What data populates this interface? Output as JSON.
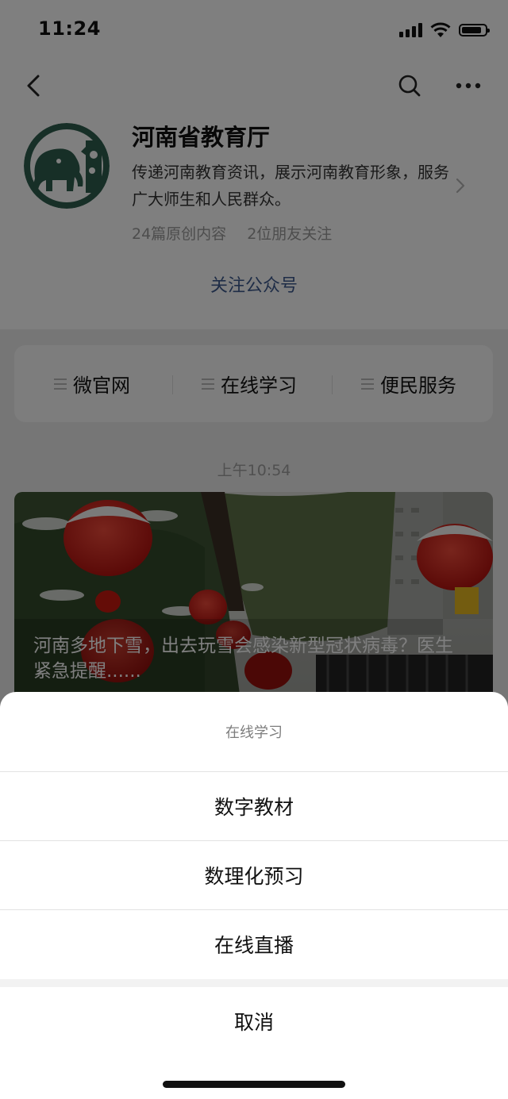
{
  "status_bar": {
    "time": "11:24"
  },
  "account": {
    "name": "河南省教育厅",
    "description": "传递河南教育资讯，展示河南教育形象，服务广大师生和人民群众。",
    "original_articles": "24篇原创内容",
    "friends_following": "2位朋友关注",
    "follow_label": "关注公众号"
  },
  "menu": {
    "items": [
      {
        "label": "微官网",
        "icon": "menu-lines-icon"
      },
      {
        "label": "在线学习",
        "icon": "menu-lines-icon"
      },
      {
        "label": "便民服务",
        "icon": "menu-lines-icon"
      }
    ]
  },
  "message": {
    "time": "上午10:54",
    "article_title": "河南多地下雪，出去玩雪会感染新型冠状病毒？医生紧急提醒......"
  },
  "action_sheet": {
    "title": "在线学习",
    "options": [
      "数字教材",
      "数理化预习",
      "在线直播"
    ],
    "cancel_label": "取消"
  },
  "colors": {
    "follow_link": "#3e5b8f",
    "avatar_green": "#2e5e4e",
    "lantern_red": "#d8201c"
  }
}
